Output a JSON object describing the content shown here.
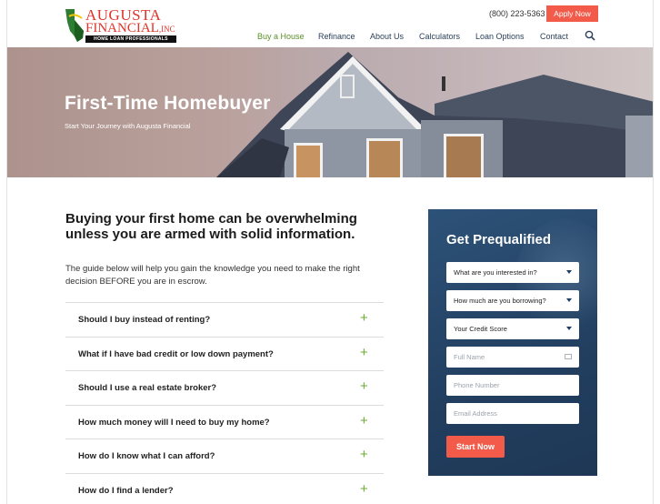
{
  "header": {
    "logo": {
      "line1": "AUGUSTA",
      "line2": "FINANCIAL",
      "line2_suffix": ",INC",
      "tagline": "HOME LOAN PROFESSIONALS"
    },
    "phone": "(800) 223-5363",
    "apply_label": "Apply Now",
    "nav": [
      {
        "label": "Buy a House",
        "active": true
      },
      {
        "label": "Refinance"
      },
      {
        "label": "About Us"
      },
      {
        "label": "Calculators"
      },
      {
        "label": "Loan Options"
      },
      {
        "label": "Contact"
      }
    ],
    "search_icon": "search-icon"
  },
  "hero": {
    "title": "First-Time Homebuyer",
    "subtitle": "Start Your Journey with Augusta Financial"
  },
  "main": {
    "lead": "Buying your first home can be overwhelming unless you are armed with solid information.",
    "intro": "The guide below will help you gain the knowledge you need to make the right decision BEFORE you are in escrow.",
    "faq": [
      "Should I buy instead of renting?",
      "What if I have bad credit or low down payment?",
      "Should I use a real estate broker?",
      "How much money will I need to buy my home?",
      "How do I know what I can afford?",
      "How do I find a lender?"
    ]
  },
  "form": {
    "title": "Get Prequalified",
    "selects": [
      "What are you interested in?",
      "How much are you borrowing?",
      "Your Credit Score"
    ],
    "inputs": {
      "name": "Full Name",
      "phone": "Phone Number",
      "email": "Email Address"
    },
    "submit": "Start Now"
  },
  "colors": {
    "accent_red": "#f25a4a",
    "nav_active_green": "#5a8f28",
    "plus_green": "#6bab35",
    "panel_blue": "#223f60"
  }
}
